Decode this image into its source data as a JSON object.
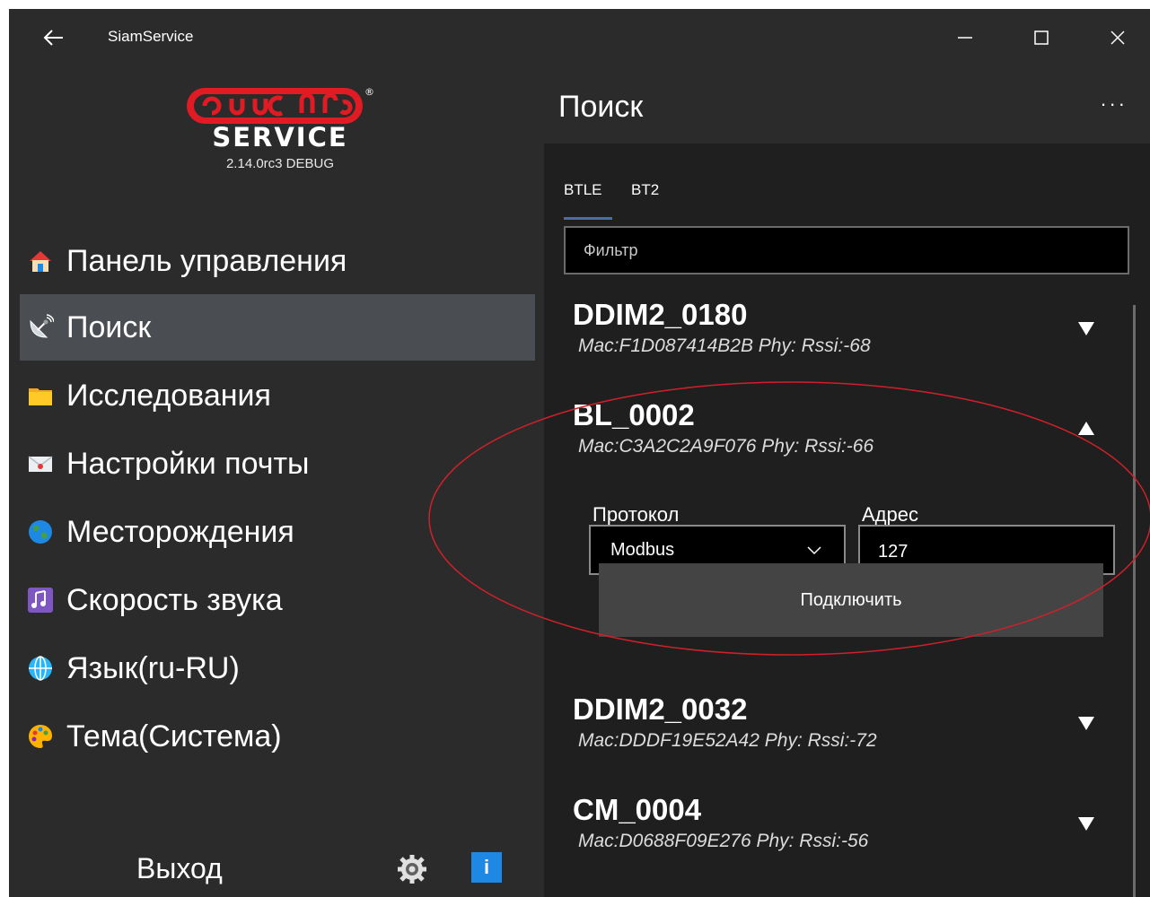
{
  "window": {
    "title": "SiamService",
    "back_icon": "back-arrow-icon",
    "minimize_icon": "minimize-icon",
    "maximize_icon": "maximize-icon",
    "close_icon": "close-icon"
  },
  "sidebar": {
    "logo_service_text": "SERVICE",
    "logo_brand_text": "siam®",
    "version": "2.14.0rc3 DEBUG",
    "items": [
      {
        "label": "Панель управления",
        "icon": "home-icon",
        "active": false
      },
      {
        "label": "Поиск",
        "icon": "satellite-dish-icon",
        "active": true
      },
      {
        "label": "Исследования",
        "icon": "folder-icon",
        "active": false
      },
      {
        "label": "Настройки почты",
        "icon": "mail-icon",
        "active": false
      },
      {
        "label": "Месторождения",
        "icon": "globe-icon",
        "active": false
      },
      {
        "label": "Скорость звука",
        "icon": "music-icon",
        "active": false
      },
      {
        "label": "Язык(ru-RU)",
        "icon": "language-icon",
        "active": false
      },
      {
        "label": "Тема(Система)",
        "icon": "palette-icon",
        "active": false
      }
    ],
    "exit_label": "Выход",
    "settings_icon": "gear-icon",
    "info_label": "i"
  },
  "main": {
    "title": "Поиск",
    "more_label": "...",
    "tabs": [
      {
        "label": "BTLE",
        "selected": true
      },
      {
        "label": "BT2",
        "selected": false
      }
    ],
    "filter_placeholder": "Фильтр",
    "devices": [
      {
        "name": "DDIM2_0180",
        "info": "Mac:F1D087414B2B Phy: Rssi:-68",
        "expanded": false
      },
      {
        "name": "BL_0002",
        "info": "Mac:C3A2C2A9F076 Phy: Rssi:-66",
        "expanded": true
      },
      {
        "name": "DDIM2_0032",
        "info": "Mac:DDDF19E52A42 Phy: Rssi:-72",
        "expanded": false
      },
      {
        "name": "CM_0004",
        "info": "Mac:D0688F09E276 Phy: Rssi:-56",
        "expanded": false
      }
    ],
    "expanded_panel": {
      "protocol_label": "Протокол",
      "protocol_value": "Modbus",
      "address_label": "Адрес",
      "address_value": "127",
      "connect_label": "Подключить"
    }
  },
  "colors": {
    "background": "#2b2b2b",
    "active_item": "#4a4d52",
    "content_bg": "#1f1f1f",
    "annotation": "#d0202a",
    "info_button": "#1e88e5"
  }
}
